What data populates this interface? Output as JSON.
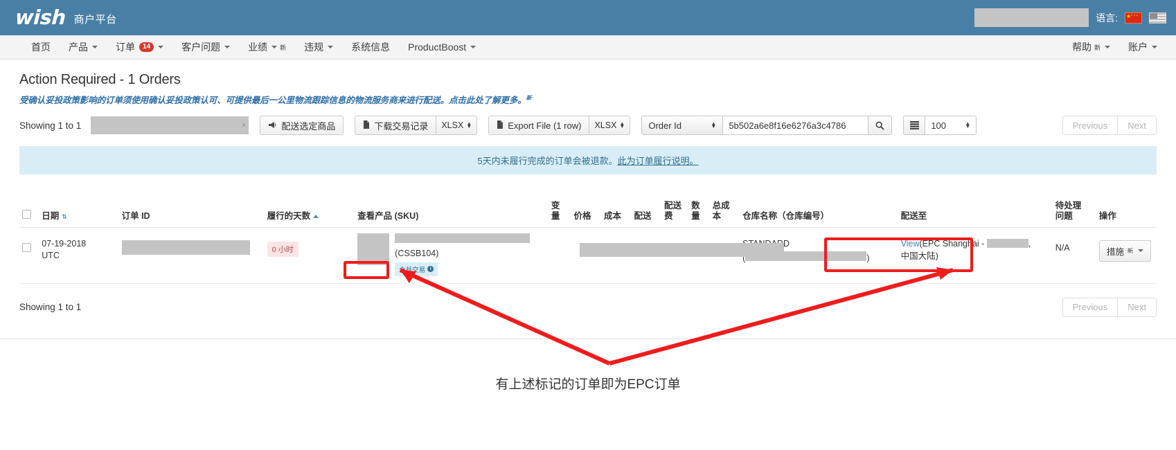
{
  "header": {
    "logo_text": "wish",
    "brand_subtitle": "商户平台",
    "language_label": "语言:",
    "flags": [
      "cn-flag-icon",
      "us-flag-icon"
    ]
  },
  "nav": {
    "items": [
      {
        "label": "首页",
        "has_caret": false,
        "badge": null,
        "new": false
      },
      {
        "label": "产品",
        "has_caret": true,
        "badge": null,
        "new": false
      },
      {
        "label": "订单",
        "has_caret": true,
        "badge": "14",
        "new": false
      },
      {
        "label": "客户问题",
        "has_caret": true,
        "badge": null,
        "new": false
      },
      {
        "label": "业绩",
        "has_caret": true,
        "badge": null,
        "new": true
      },
      {
        "label": "违规",
        "has_caret": true,
        "badge": null,
        "new": false
      },
      {
        "label": "系统信息",
        "has_caret": false,
        "badge": null,
        "new": false
      },
      {
        "label": "ProductBoost",
        "has_caret": true,
        "badge": null,
        "new": false
      }
    ],
    "right_items": [
      {
        "label": "帮助",
        "has_caret": true,
        "new": true
      },
      {
        "label": "账户",
        "has_caret": true,
        "new": false
      }
    ],
    "new_superscript": "新"
  },
  "page": {
    "title": "Action Required - 1 Orders",
    "subtitle": "受确认妥投政策影响的订单须使用确认妥投政策认可、可提供最后一公里物流跟踪信息的物流服务商来进行配送。",
    "subtitle_link": "点击此处了解更多。",
    "subtitle_new": "新"
  },
  "toolbar": {
    "showing_label": "Showing 1 to 1",
    "search_box_value": "",
    "clear_icon": "×",
    "ship_selected_button": "配送选定商品",
    "ship_selected_icon": "megaphone-icon",
    "download_transactions_button": "下载交易记录",
    "download_icon": "file-icon",
    "download_format": "XLSX",
    "export_file_button": "Export File (1 row)",
    "export_icon": "file-icon",
    "export_format": "XLSX",
    "filter_field": "Order Id",
    "search_value": "5b502a6e8f16e6276a3c4786",
    "search_icon": "magnifier-icon",
    "page_size_icon": "list-icon",
    "page_size": "100",
    "previous_button": "Previous",
    "next_button": "Next"
  },
  "info_banner": {
    "text": "5天内未履行完成的订单会被退款。",
    "link_text": "此为订单履行说明。"
  },
  "table": {
    "columns": [
      {
        "label": "日期",
        "sort": "both"
      },
      {
        "label": "订单 ID",
        "sort": null
      },
      {
        "label": "履行的天数",
        "sort": "asc"
      },
      {
        "label": "查看产品 (SKU)",
        "sort": null
      },
      {
        "label": "变\n量",
        "sort": null
      },
      {
        "label": "价格",
        "sort": null
      },
      {
        "label": "成本",
        "sort": null
      },
      {
        "label": "配送",
        "sort": null
      },
      {
        "label": "配送\n费",
        "sort": null
      },
      {
        "label": "数\n量",
        "sort": null
      },
      {
        "label": "总成\n本",
        "sort": null
      },
      {
        "label": "仓库名称（仓库编号）",
        "sort": null
      },
      {
        "label": "配送至",
        "sort": null
      },
      {
        "label": "待处理\n问题",
        "sort": null
      },
      {
        "label": "操作",
        "sort": null
      }
    ],
    "rows": [
      {
        "date": "07-19-2018\nUTC",
        "order_id": "[redacted]",
        "fulfillment_hours": "0 小时",
        "sku_thumb": "product-thumbnail",
        "sku_name": "[redacted]",
        "sku_code": "(CSSB104)",
        "merge_badge": "合并交易",
        "merge_badge_icon": "info-icon",
        "variant": "[redacted]",
        "warehouse_name": "STANDARD",
        "warehouse_code": "[redacted]",
        "ship_to_link": "View",
        "ship_to_text_open": "(EPC Shanghai - ",
        "ship_to_redacted": "[redacted]",
        "ship_to_text_close": "中国大陆)",
        "pending_issue": "N/A",
        "action_button": "措施",
        "action_button_sup": "新"
      }
    ]
  },
  "footer": {
    "showing_label": "Showing 1 to 1",
    "previous_button": "Previous",
    "next_button": "Next"
  },
  "annotation": {
    "caption": "有上述标记的订单即为EPC订单",
    "color": "#ee1c1c"
  }
}
